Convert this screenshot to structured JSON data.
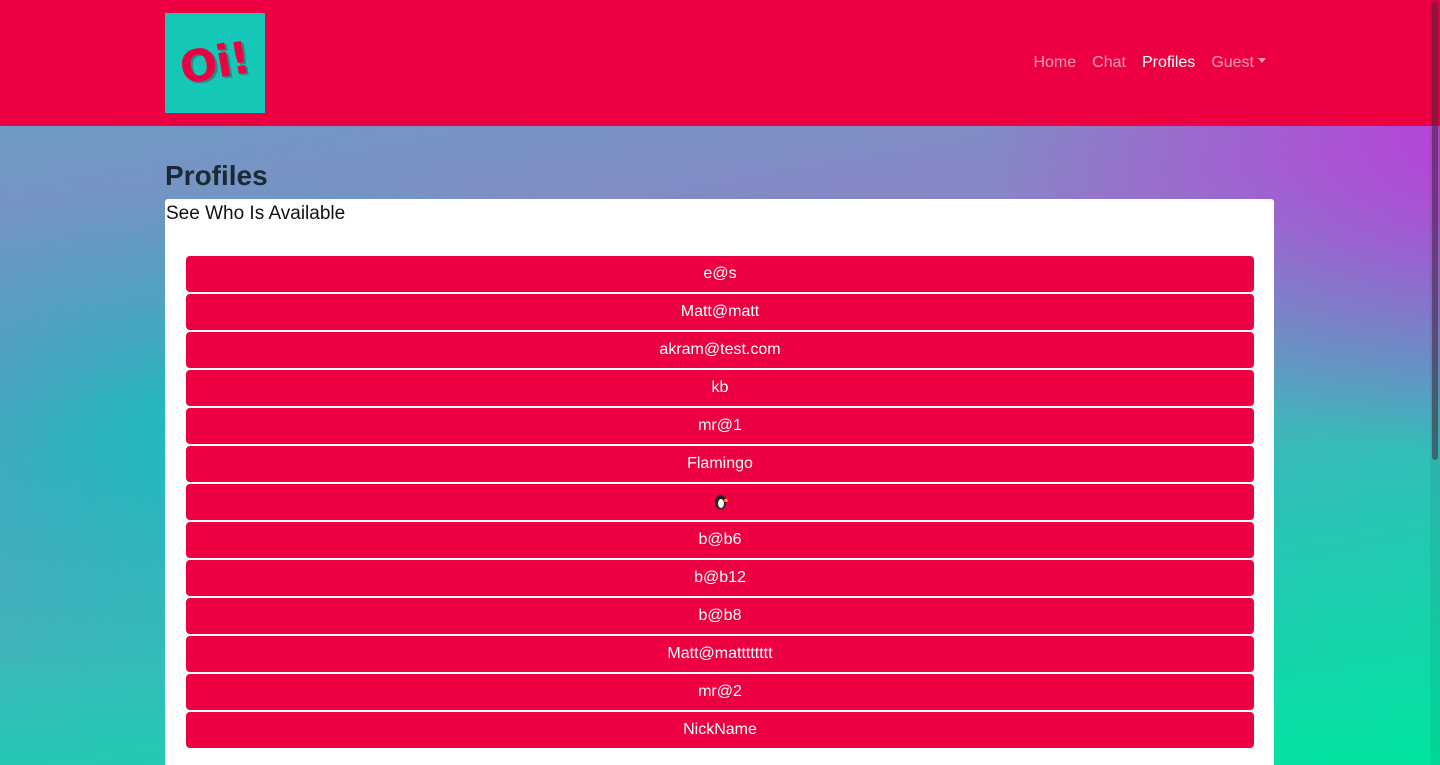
{
  "navbar": {
    "logo_text": "Oi!",
    "links": [
      {
        "label": "Home",
        "active": false
      },
      {
        "label": "Chat",
        "active": false
      },
      {
        "label": "Profiles",
        "active": true
      }
    ],
    "user_dropdown": {
      "label": "Guest"
    }
  },
  "page": {
    "title": "Profiles",
    "card_title": "See Who Is Available"
  },
  "profiles": [
    {
      "label": "e@s"
    },
    {
      "label": "Matt@matt"
    },
    {
      "label": "akram@test.com"
    },
    {
      "label": "kb"
    },
    {
      "label": "mr@1"
    },
    {
      "label": "Flamingo"
    },
    {
      "label": "",
      "icon": "penguin-emoji-icon"
    },
    {
      "label": "b@b6"
    },
    {
      "label": "b@b12"
    },
    {
      "label": "b@b8"
    },
    {
      "label": "Matt@matttttttt"
    },
    {
      "label": "mr@2"
    },
    {
      "label": "NickName"
    }
  ],
  "colors": {
    "brand": "#ec0041",
    "logo_bg": "#14c7b6"
  }
}
